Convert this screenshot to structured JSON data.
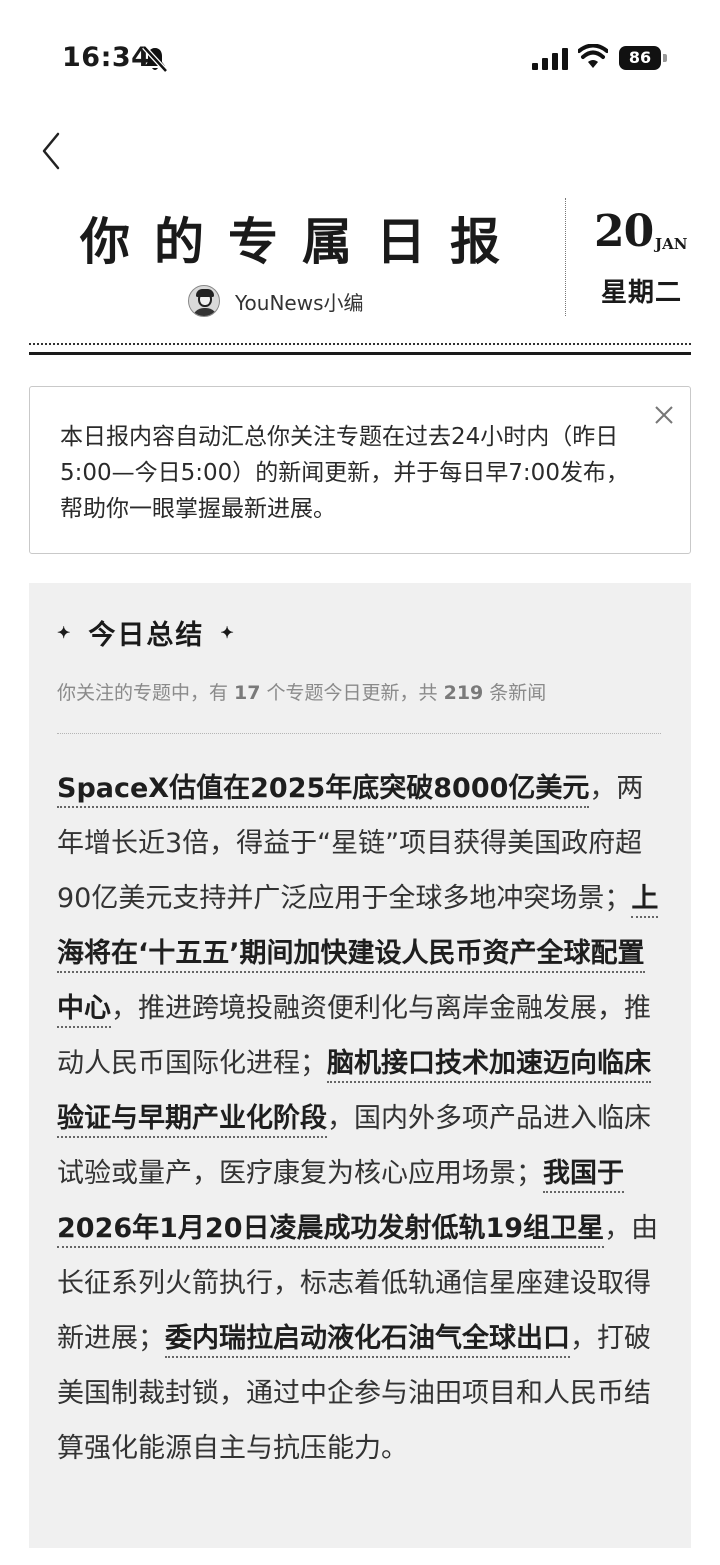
{
  "status_bar": {
    "time": "16:34",
    "battery": "86"
  },
  "header": {
    "title": "你的专属日报",
    "author": "YouNews小编",
    "date_day": "20",
    "date_month": "JAN",
    "weekday": "星期二"
  },
  "notice": {
    "text": "本日报内容自动汇总你关注专题在过去24小时内（昨日5:00—今日5:00）的新闻更新，并于每日早7:00发布，帮助你一眼掌握最新进展。"
  },
  "summary": {
    "title": "今日总结",
    "stats_prefix": "你关注的专题中，有 ",
    "topics_count": "17",
    "stats_mid": " 个专题今日更新，共 ",
    "news_count": "219",
    "stats_suffix": " 条新闻",
    "segments": [
      {
        "text": "SpaceX估值在2025年底突破8000亿美元",
        "highlight": true
      },
      {
        "text": "，两年增长近3倍，得益于“星链”项目获得美国政府超90亿美元支持并广泛应用于全球多地冲突场景；",
        "highlight": false
      },
      {
        "text": "上海将在‘十五五’期间加快建设人民币资产全球配置中心",
        "highlight": true
      },
      {
        "text": "，推进跨境投融资便利化与离岸金融发展，推动人民币国际化进程；",
        "highlight": false
      },
      {
        "text": "脑机接口技术加速迈向临床验证与早期产业化阶段",
        "highlight": true
      },
      {
        "text": "，国内外多项产品进入临床试验或量产，医疗康复为核心应用场景；",
        "highlight": false
      },
      {
        "text": "我国于2026年1月20日凌晨成功发射低轨19组卫星",
        "highlight": true
      },
      {
        "text": "，由长征系列火箭执行，标志着低轨通信星座建设取得新进展；",
        "highlight": false
      },
      {
        "text": "委内瑞拉启动液化石油气全球出口",
        "highlight": true
      },
      {
        "text": "，打破美国制裁封锁，通过中企参与油田项目和人民币结算强化能源自主与抗压能力。",
        "highlight": false
      }
    ]
  }
}
